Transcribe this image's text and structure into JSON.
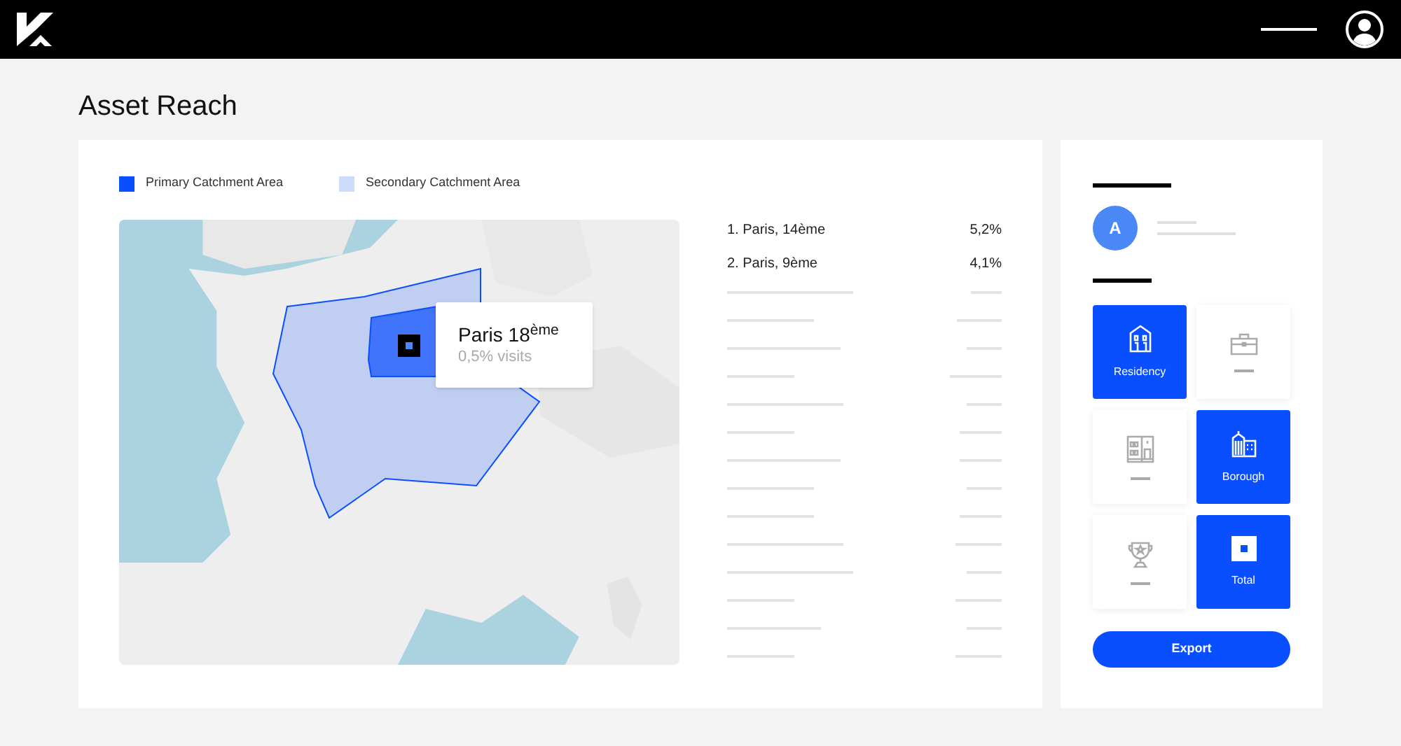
{
  "page": {
    "title": "Asset Reach"
  },
  "legend": [
    {
      "label": "Primary Catchment Area",
      "color": "#0a4fff"
    },
    {
      "label": "Secondary Catchment Area",
      "color": "#cddcfb"
    }
  ],
  "map": {
    "kind": "picture",
    "tooltip": {
      "title": "Paris 18$^{ème}$",
      "subtitle": "0,5% visits"
    }
  },
  "ranking": [
    {
      "name": "1. Paris, 14ème",
      "value": "5,2%"
    },
    {
      "name": "2. Paris, 9ème",
      "value": "4,1%"
    }
  ],
  "profile": {
    "initial": "A"
  },
  "tiles": [
    {
      "kind": "residency",
      "label": "Residency",
      "selected": true
    },
    {
      "kind": "briefcase",
      "selected": false
    },
    {
      "kind": "building",
      "selected": false
    },
    {
      "kind": "borough",
      "label": "Borough",
      "selected": true
    },
    {
      "kind": "trophy",
      "selected": false
    },
    {
      "kind": "total",
      "label": "Total",
      "selected": true
    }
  ],
  "export_button": "Export"
}
